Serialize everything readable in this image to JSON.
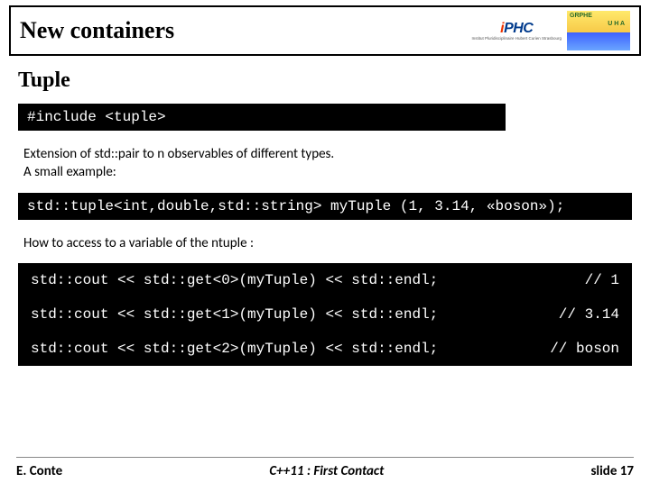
{
  "title": "New containers",
  "logo_iphc": {
    "i": "i",
    "phc": "PHC",
    "sub": "Institut Pluridisciplinaire\nHubert Curien\nStrasbourg"
  },
  "logo_grphe": {
    "top": "GRPHE",
    "uha": "U H A"
  },
  "section": "Tuple",
  "code_include": "#include <tuple>",
  "desc": "Extension of std::pair to n observables of different types.\nA small example:",
  "code_decl": "std::tuple<int,double,std::string> myTuple (1, 3.14, «boson»);",
  "access_text": "How to access to a variable of the ntuple :",
  "code_rows": [
    {
      "left": "std::cout << std::get<0>(myTuple) << std::endl;",
      "right": "// 1"
    },
    {
      "left": "std::cout << std::get<1>(myTuple) << std::endl;",
      "right": "// 3.14"
    },
    {
      "left": "std::cout << std::get<2>(myTuple) << std::endl;",
      "right": "// boson"
    }
  ],
  "footer": {
    "left": "E. Conte",
    "center": "C++11 : First Contact",
    "right": "slide 17"
  }
}
